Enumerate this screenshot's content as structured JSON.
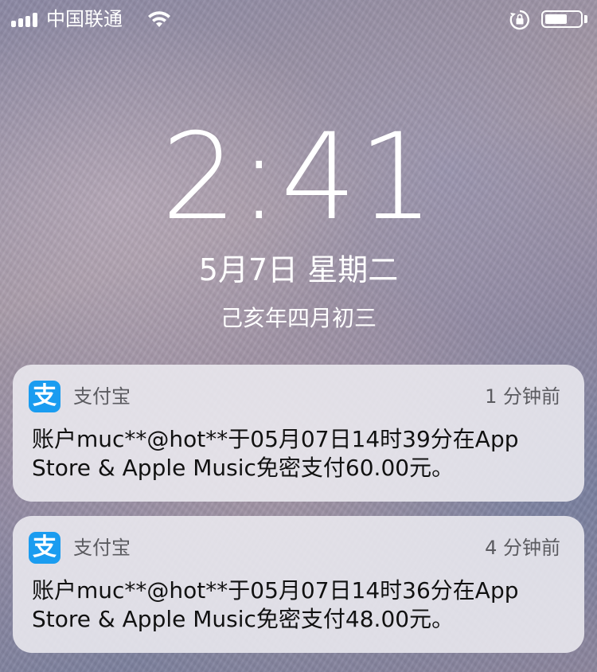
{
  "status_bar": {
    "carrier": "中国联通",
    "signal_bars": 4,
    "battery_level": 0.65
  },
  "lock_screen": {
    "time": "2:41",
    "date": "5月7日 星期二",
    "lunar_date": "己亥年四月初三"
  },
  "notifications": [
    {
      "app_name": "支付宝",
      "app_icon": "alipay-icon",
      "icon_glyph": "支",
      "time_ago": "1 分钟前",
      "body": "账户muc**@hot**于05月07日14时39分在App Store & Apple Music免密支付60.00元。"
    },
    {
      "app_name": "支付宝",
      "app_icon": "alipay-icon",
      "icon_glyph": "支",
      "time_ago": "4 分钟前",
      "body": "账户muc**@hot**于05月07日14时36分在App Store & Apple Music免密支付48.00元。"
    }
  ],
  "colors": {
    "alipay_blue": "#1a9cf0",
    "notification_bg": "#ecEAF0"
  }
}
